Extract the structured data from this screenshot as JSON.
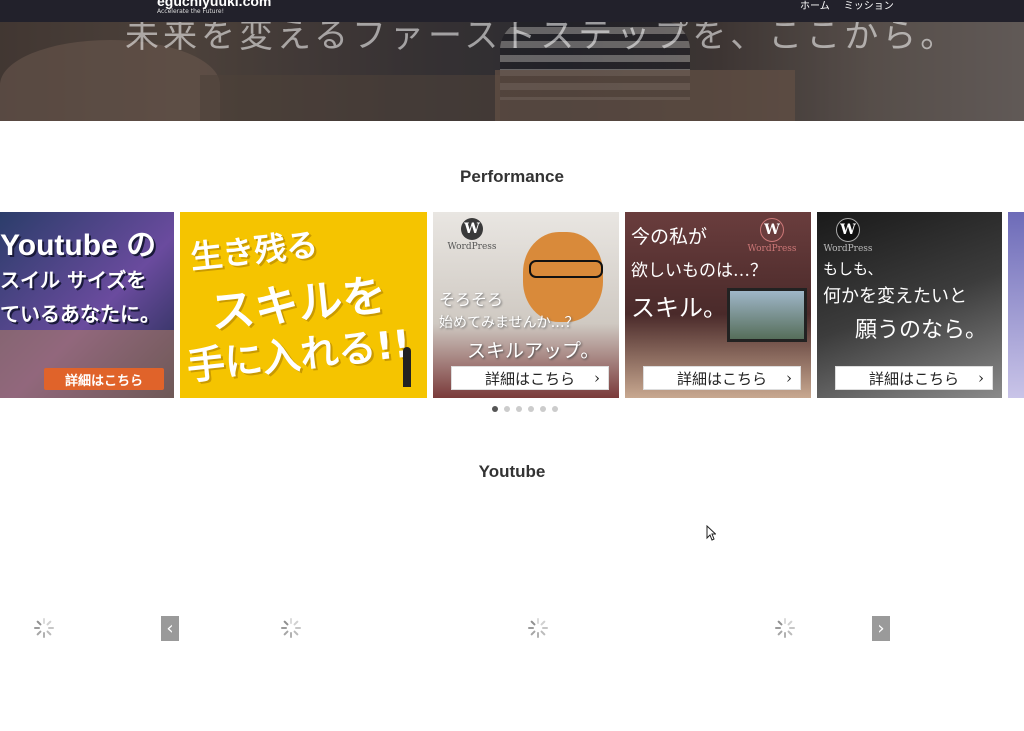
{
  "header": {
    "logo": "eguchiyuuki.com",
    "logo_tagline": "Accelerate the Future!",
    "nav": [
      "ホーム",
      "ミッション"
    ],
    "hero_tagline": "未来を変えるファーストステップを、ここから。"
  },
  "performance": {
    "title": "Performance",
    "slides": [
      {
        "line1": "Youtube の",
        "line2": "スイル サイズを",
        "line3": "ているあなたに。",
        "cta": "詳細はこちら"
      },
      {
        "line1": "生き残る",
        "line2": "スキルを",
        "line3": "手に入れる!!"
      },
      {
        "brand": "WordPress",
        "line1": "そろそろ",
        "line2": "始めてみませんか…？",
        "line3": "スキルアップ。",
        "cta": "詳細はこちら"
      },
      {
        "brand": "WordPress",
        "line1": "今の私が",
        "line2": "欲しいものは…？",
        "line3": "スキル。",
        "cta": "詳細はこちら"
      },
      {
        "brand": "WordPress",
        "line1": "もしも、",
        "line2": "何かを変えたいと",
        "line3": "願うのなら。",
        "cta": "詳細はこちら"
      }
    ],
    "dots_total": 6,
    "dots_active": 1
  },
  "youtube": {
    "title": "Youtube",
    "prev_icon": "‹",
    "next_icon": "›"
  },
  "colors": {
    "nav_bg": "#22212b",
    "yellow": "#f5c400",
    "cta_orange": "#e0632a"
  }
}
